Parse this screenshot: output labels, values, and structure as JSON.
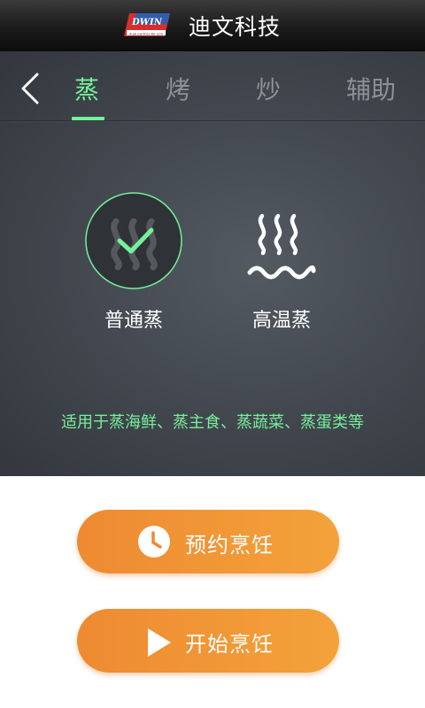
{
  "header": {
    "brand_name": "迪文科技",
    "logo_text": "DWIN",
    "logo_tagline": "dual partner for you"
  },
  "tabs": [
    {
      "label": "蒸",
      "active": true
    },
    {
      "label": "烤",
      "active": false
    },
    {
      "label": "炒",
      "active": false
    },
    {
      "label": "辅助",
      "active": false
    }
  ],
  "modes": [
    {
      "label": "普通蒸",
      "selected": true,
      "icon": "steam-check-icon"
    },
    {
      "label": "高温蒸",
      "selected": false,
      "icon": "high-temp-steam-icon"
    }
  ],
  "hint": "适用于蒸海鲜、蒸主食、蒸蔬菜、蒸蛋类等",
  "actions": {
    "schedule_label": "预约烹饪",
    "start_label": "开始烹饪"
  },
  "colors": {
    "accent_green": "#76f09a",
    "button_orange_start": "#ee8a32",
    "button_orange_end": "#f3a23a",
    "panel_dark": "#41464d"
  }
}
